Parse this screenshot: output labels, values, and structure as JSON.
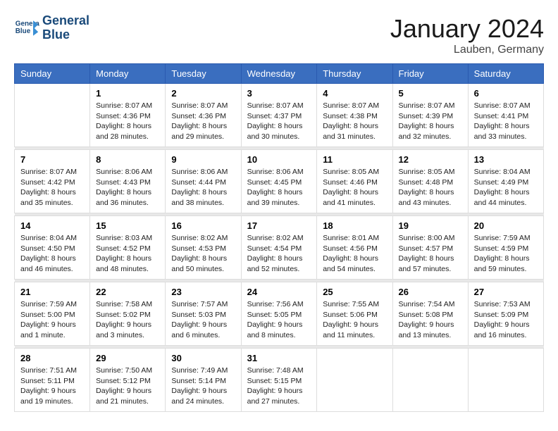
{
  "header": {
    "logo_line1": "General",
    "logo_line2": "Blue",
    "month_title": "January 2024",
    "location": "Lauben, Germany"
  },
  "weekdays": [
    "Sunday",
    "Monday",
    "Tuesday",
    "Wednesday",
    "Thursday",
    "Friday",
    "Saturday"
  ],
  "weeks": [
    [
      {
        "day": "",
        "sunrise": "",
        "sunset": "",
        "daylight": ""
      },
      {
        "day": "1",
        "sunrise": "Sunrise: 8:07 AM",
        "sunset": "Sunset: 4:36 PM",
        "daylight": "Daylight: 8 hours and 28 minutes."
      },
      {
        "day": "2",
        "sunrise": "Sunrise: 8:07 AM",
        "sunset": "Sunset: 4:36 PM",
        "daylight": "Daylight: 8 hours and 29 minutes."
      },
      {
        "day": "3",
        "sunrise": "Sunrise: 8:07 AM",
        "sunset": "Sunset: 4:37 PM",
        "daylight": "Daylight: 8 hours and 30 minutes."
      },
      {
        "day": "4",
        "sunrise": "Sunrise: 8:07 AM",
        "sunset": "Sunset: 4:38 PM",
        "daylight": "Daylight: 8 hours and 31 minutes."
      },
      {
        "day": "5",
        "sunrise": "Sunrise: 8:07 AM",
        "sunset": "Sunset: 4:39 PM",
        "daylight": "Daylight: 8 hours and 32 minutes."
      },
      {
        "day": "6",
        "sunrise": "Sunrise: 8:07 AM",
        "sunset": "Sunset: 4:41 PM",
        "daylight": "Daylight: 8 hours and 33 minutes."
      }
    ],
    [
      {
        "day": "7",
        "sunrise": "Sunrise: 8:07 AM",
        "sunset": "Sunset: 4:42 PM",
        "daylight": "Daylight: 8 hours and 35 minutes."
      },
      {
        "day": "8",
        "sunrise": "Sunrise: 8:06 AM",
        "sunset": "Sunset: 4:43 PM",
        "daylight": "Daylight: 8 hours and 36 minutes."
      },
      {
        "day": "9",
        "sunrise": "Sunrise: 8:06 AM",
        "sunset": "Sunset: 4:44 PM",
        "daylight": "Daylight: 8 hours and 38 minutes."
      },
      {
        "day": "10",
        "sunrise": "Sunrise: 8:06 AM",
        "sunset": "Sunset: 4:45 PM",
        "daylight": "Daylight: 8 hours and 39 minutes."
      },
      {
        "day": "11",
        "sunrise": "Sunrise: 8:05 AM",
        "sunset": "Sunset: 4:46 PM",
        "daylight": "Daylight: 8 hours and 41 minutes."
      },
      {
        "day": "12",
        "sunrise": "Sunrise: 8:05 AM",
        "sunset": "Sunset: 4:48 PM",
        "daylight": "Daylight: 8 hours and 43 minutes."
      },
      {
        "day": "13",
        "sunrise": "Sunrise: 8:04 AM",
        "sunset": "Sunset: 4:49 PM",
        "daylight": "Daylight: 8 hours and 44 minutes."
      }
    ],
    [
      {
        "day": "14",
        "sunrise": "Sunrise: 8:04 AM",
        "sunset": "Sunset: 4:50 PM",
        "daylight": "Daylight: 8 hours and 46 minutes."
      },
      {
        "day": "15",
        "sunrise": "Sunrise: 8:03 AM",
        "sunset": "Sunset: 4:52 PM",
        "daylight": "Daylight: 8 hours and 48 minutes."
      },
      {
        "day": "16",
        "sunrise": "Sunrise: 8:02 AM",
        "sunset": "Sunset: 4:53 PM",
        "daylight": "Daylight: 8 hours and 50 minutes."
      },
      {
        "day": "17",
        "sunrise": "Sunrise: 8:02 AM",
        "sunset": "Sunset: 4:54 PM",
        "daylight": "Daylight: 8 hours and 52 minutes."
      },
      {
        "day": "18",
        "sunrise": "Sunrise: 8:01 AM",
        "sunset": "Sunset: 4:56 PM",
        "daylight": "Daylight: 8 hours and 54 minutes."
      },
      {
        "day": "19",
        "sunrise": "Sunrise: 8:00 AM",
        "sunset": "Sunset: 4:57 PM",
        "daylight": "Daylight: 8 hours and 57 minutes."
      },
      {
        "day": "20",
        "sunrise": "Sunrise: 7:59 AM",
        "sunset": "Sunset: 4:59 PM",
        "daylight": "Daylight: 8 hours and 59 minutes."
      }
    ],
    [
      {
        "day": "21",
        "sunrise": "Sunrise: 7:59 AM",
        "sunset": "Sunset: 5:00 PM",
        "daylight": "Daylight: 9 hours and 1 minute."
      },
      {
        "day": "22",
        "sunrise": "Sunrise: 7:58 AM",
        "sunset": "Sunset: 5:02 PM",
        "daylight": "Daylight: 9 hours and 3 minutes."
      },
      {
        "day": "23",
        "sunrise": "Sunrise: 7:57 AM",
        "sunset": "Sunset: 5:03 PM",
        "daylight": "Daylight: 9 hours and 6 minutes."
      },
      {
        "day": "24",
        "sunrise": "Sunrise: 7:56 AM",
        "sunset": "Sunset: 5:05 PM",
        "daylight": "Daylight: 9 hours and 8 minutes."
      },
      {
        "day": "25",
        "sunrise": "Sunrise: 7:55 AM",
        "sunset": "Sunset: 5:06 PM",
        "daylight": "Daylight: 9 hours and 11 minutes."
      },
      {
        "day": "26",
        "sunrise": "Sunrise: 7:54 AM",
        "sunset": "Sunset: 5:08 PM",
        "daylight": "Daylight: 9 hours and 13 minutes."
      },
      {
        "day": "27",
        "sunrise": "Sunrise: 7:53 AM",
        "sunset": "Sunset: 5:09 PM",
        "daylight": "Daylight: 9 hours and 16 minutes."
      }
    ],
    [
      {
        "day": "28",
        "sunrise": "Sunrise: 7:51 AM",
        "sunset": "Sunset: 5:11 PM",
        "daylight": "Daylight: 9 hours and 19 minutes."
      },
      {
        "day": "29",
        "sunrise": "Sunrise: 7:50 AM",
        "sunset": "Sunset: 5:12 PM",
        "daylight": "Daylight: 9 hours and 21 minutes."
      },
      {
        "day": "30",
        "sunrise": "Sunrise: 7:49 AM",
        "sunset": "Sunset: 5:14 PM",
        "daylight": "Daylight: 9 hours and 24 minutes."
      },
      {
        "day": "31",
        "sunrise": "Sunrise: 7:48 AM",
        "sunset": "Sunset: 5:15 PM",
        "daylight": "Daylight: 9 hours and 27 minutes."
      },
      {
        "day": "",
        "sunrise": "",
        "sunset": "",
        "daylight": ""
      },
      {
        "day": "",
        "sunrise": "",
        "sunset": "",
        "daylight": ""
      },
      {
        "day": "",
        "sunrise": "",
        "sunset": "",
        "daylight": ""
      }
    ]
  ]
}
